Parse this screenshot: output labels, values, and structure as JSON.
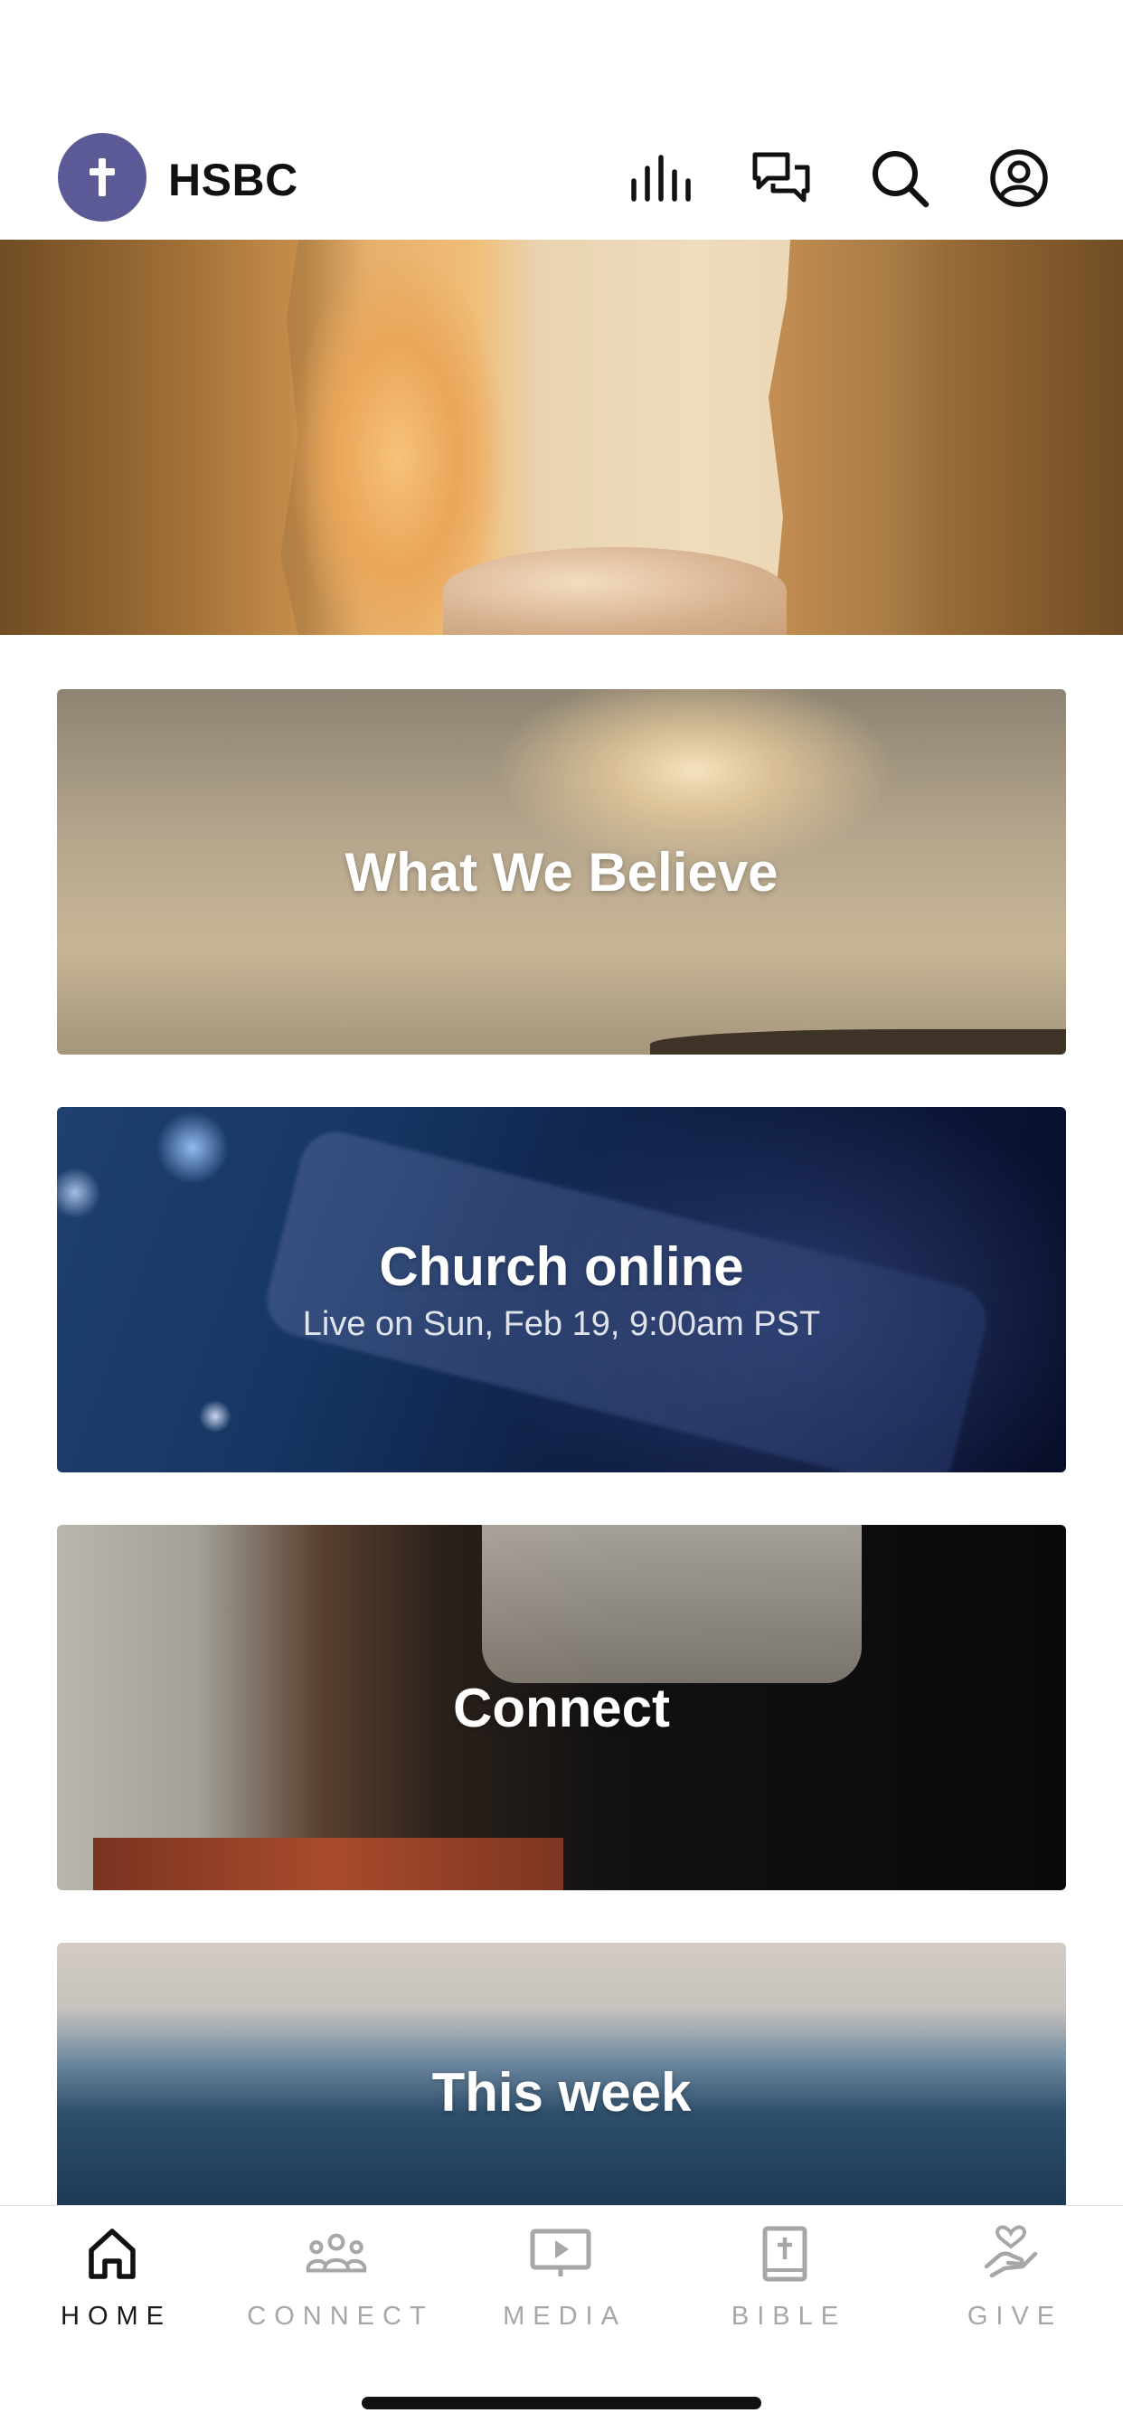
{
  "header": {
    "title": "HSBC",
    "logo_icon": "cross-icon",
    "logo_color": "#5b5a96",
    "actions": [
      {
        "name": "audio-bars-icon"
      },
      {
        "name": "chat-icon"
      },
      {
        "name": "search-icon"
      },
      {
        "name": "profile-icon"
      }
    ]
  },
  "hero": {
    "image": "empty-tomb-stone-opening"
  },
  "cards": [
    {
      "title": "What We Believe",
      "subtitle": ""
    },
    {
      "title": "Church online",
      "subtitle": "Live on Sun, Feb 19, 9:00am PST"
    },
    {
      "title": "Connect",
      "subtitle": ""
    },
    {
      "title": "This week",
      "subtitle": ""
    }
  ],
  "tabbar": {
    "active": "HOME",
    "tabs": [
      {
        "label": "HOME",
        "icon": "home-icon"
      },
      {
        "label": "CONNECT",
        "icon": "group-icon"
      },
      {
        "label": "MEDIA",
        "icon": "play-screen-icon"
      },
      {
        "label": "BIBLE",
        "icon": "bible-icon"
      },
      {
        "label": "GIVE",
        "icon": "heart-hand-icon"
      }
    ]
  }
}
